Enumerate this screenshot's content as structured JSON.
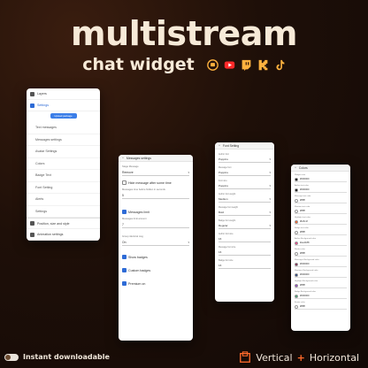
{
  "hero": {
    "title": "multistream",
    "subtitle": "chat widget",
    "platforms": [
      "streamlabs-icon",
      "youtube-icon",
      "twitch-icon",
      "kick-icon",
      "tiktok-icon"
    ],
    "colors": {
      "title": "#f7ead8",
      "accent": "#ff6a2b",
      "youtube": "#ff2a2a",
      "twitch": "#9146ff",
      "kick": "#53fc18",
      "streamlabs": "#ffb23f"
    }
  },
  "panel_menu": {
    "items": [
      {
        "label": "Layers"
      },
      {
        "label": "Settings"
      }
    ],
    "upload_button": "Upload package",
    "sub_items": [
      "Text messages",
      "Messages settings",
      "Avatar Settings",
      "Colors",
      "Badge Text",
      "Font Setting",
      "Alerts",
      "Settings"
    ],
    "footer": [
      "Position, size and style",
      "Animation settings"
    ]
  },
  "panel_messages": {
    "header": "Messages settings",
    "fields": {
      "message_style_label": "Stage Message",
      "message_style_value": "Remove",
      "hide_after_label": "Hide message after some time",
      "seconds_label": "Messages time before hidden in seconds",
      "seconds_value": "5",
      "messages_limit_label": "Messages limit",
      "limit_count_label": "Messages limit amount",
      "limit_count_value": "7",
      "group_label": "Group identical msg",
      "group_value": "On",
      "show_badges": "Show badges",
      "custom_badges": "Custom badges",
      "premium_on": "Premium on"
    }
  },
  "panel_font": {
    "header": "Font Setting",
    "fields": [
      {
        "label": "Author font",
        "value": "Poppins"
      },
      {
        "label": "Message font",
        "value": "Poppins"
      },
      {
        "label": "Font size",
        "value": "Poppins"
      },
      {
        "label": "Author font weight",
        "value": "Medium"
      },
      {
        "label": "Message font weight",
        "value": "Bold"
      },
      {
        "label": "Badge font weight",
        "value": "Regular"
      },
      {
        "label": "Author font size",
        "value": "16"
      },
      {
        "label": "Message font size",
        "value": "16"
      },
      {
        "label": "Badge font size",
        "value": "16"
      }
    ]
  },
  "panel_colors": {
    "header": "Colors",
    "rows": [
      {
        "label": "Widget color",
        "value": "#000000",
        "color": "#000000"
      },
      {
        "label": "Author text color",
        "value": "#000000",
        "color": "#000000"
      },
      {
        "label": "Message text color",
        "value": "#ffffff",
        "color": "#ffffff"
      },
      {
        "label": "Mention text color",
        "value": "#ffffff",
        "color": "#ffffff"
      },
      {
        "label": "Highlight text color",
        "value": "#fe5c1f",
        "color": "#fe5c1f"
      },
      {
        "label": "Badge text color",
        "value": "#ffffff",
        "color": "#ffffff"
      },
      {
        "label": "Author Background color",
        "value": "#ee4188",
        "color": "#ee4188"
      },
      {
        "label": "Border color",
        "value": "#ffffff",
        "color": "#ffffff"
      },
      {
        "label": "Messages Background color",
        "value": "#000000",
        "color": "#7a1f4a"
      },
      {
        "label": "Mentions Background color",
        "value": "#000000",
        "color": "#1f3a7a"
      },
      {
        "label": "Highlight Background color",
        "value": "#ffffff",
        "color": "#9040c0"
      },
      {
        "label": "Badge Background color",
        "value": "#000000",
        "color": "#40a070"
      },
      {
        "label": "Emote color",
        "value": "#ffffff",
        "color": "#ffffff"
      }
    ]
  },
  "footer": {
    "left": "Instant downloadable",
    "right_a": "Vertical",
    "plus": "+",
    "right_b": "Horizontal"
  }
}
